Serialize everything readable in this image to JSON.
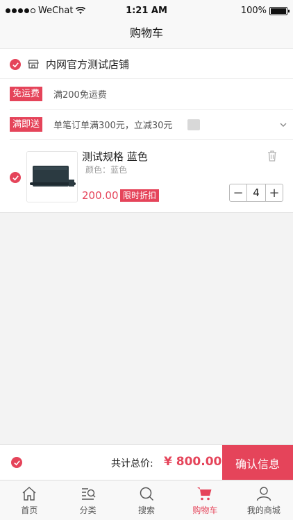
{
  "status_bar": {
    "carrier": "WeChat",
    "time": "1:21 AM",
    "battery": "100%"
  },
  "nav": {
    "title": "购物车"
  },
  "shop": {
    "name": "内网官方测试店铺"
  },
  "promotions": [
    {
      "tag": "免运费",
      "text": "满200免运费"
    },
    {
      "tag": "满即送",
      "text": "单笔订单满300元，立减30元"
    }
  ],
  "item": {
    "title": "测试规格 蓝色",
    "spec": "颜色：蓝色",
    "price": "200.00",
    "discount_tag": "限时折扣",
    "quantity": "4",
    "minus": "−",
    "plus": "+"
  },
  "checkout": {
    "total_label": "共计总价:",
    "total_value": "¥ 800.00",
    "confirm_label": "确认信息"
  },
  "tabs": [
    {
      "label": "首页",
      "icon": "home-icon"
    },
    {
      "label": "分类",
      "icon": "category-search-icon"
    },
    {
      "label": "搜索",
      "icon": "search-icon"
    },
    {
      "label": "购物车",
      "icon": "cart-icon",
      "active": true
    },
    {
      "label": "我的商城",
      "icon": "user-icon"
    }
  ],
  "colors": {
    "accent": "#e5445a",
    "background": "#f3f3f3"
  }
}
